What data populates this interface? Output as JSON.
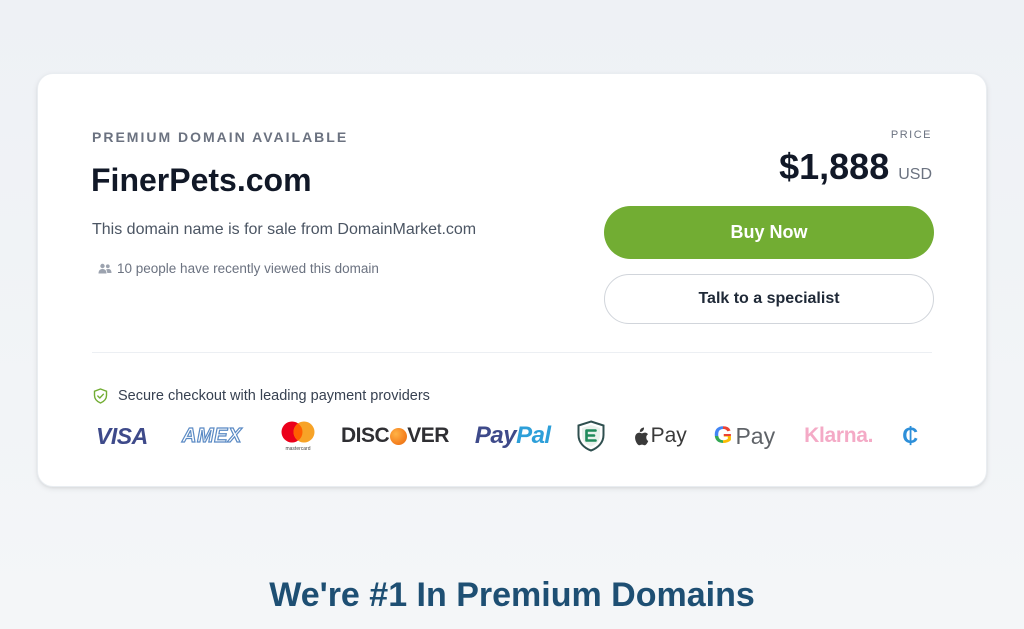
{
  "card": {
    "eyebrow": "PREMIUM DOMAIN AVAILABLE",
    "domain": "FinerPets.com",
    "description": "This domain name is for sale from DomainMarket.com",
    "viewers": "10 people have recently viewed this domain",
    "price_label": "PRICE",
    "price": "$1,888",
    "currency": "USD",
    "buy_label": "Buy Now",
    "talk_label": "Talk to a specialist",
    "secure_text": "Secure checkout with leading payment providers"
  },
  "payments": {
    "visa": "VISA",
    "amex": "AMEX",
    "mastercard_caption": "mastercard",
    "discover_pre": "DISC",
    "discover_post": "VER",
    "paypal_1": "Pay",
    "paypal_2": "Pal",
    "apple_pay": "Pay",
    "google_pay": "Pay",
    "google_g": "G",
    "klarna": "Klarna.",
    "crypto": "₵"
  },
  "footer": {
    "heading": "We're #1 In Premium Domains"
  },
  "colors": {
    "buy_button": "#72ad33",
    "heading": "#1e4f73"
  }
}
